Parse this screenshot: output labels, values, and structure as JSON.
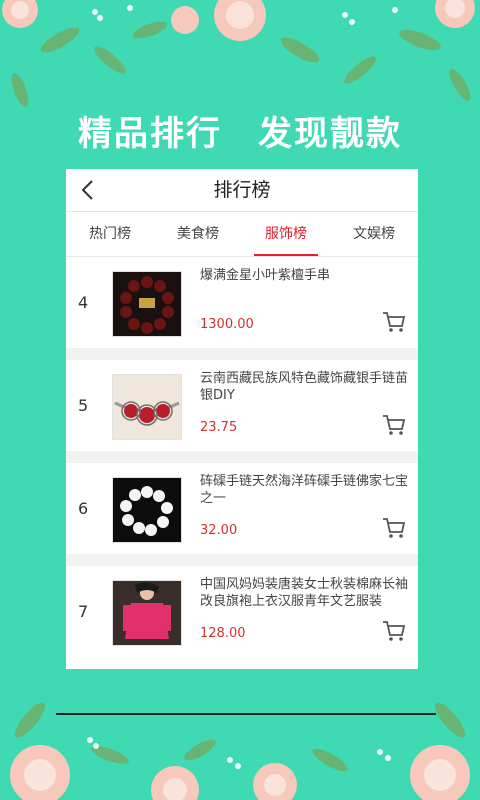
{
  "headline": "精品排行　发现靓款",
  "title": "排行榜",
  "colors": {
    "background": "#3fd9b4",
    "accent": "#e0202e",
    "price": "#d0332c"
  },
  "tabs": [
    {
      "label": "热门榜",
      "active": false
    },
    {
      "label": "美食榜",
      "active": false
    },
    {
      "label": "服饰榜",
      "active": true
    },
    {
      "label": "文娱榜",
      "active": false
    }
  ],
  "items": [
    {
      "rank": "4",
      "name": "爆满金星小叶紫檀手串",
      "price": "1300.00"
    },
    {
      "rank": "5",
      "name": "云南西藏民族风特色藏饰藏银手链苗银DIY",
      "price": "23.75"
    },
    {
      "rank": "6",
      "name": "砗磲手链天然海洋砗磲手链佛家七宝之一",
      "price": "32.00"
    },
    {
      "rank": "7",
      "name": "中国风妈妈装唐装女士秋装棉麻长袖改良旗袍上衣汉服青年文艺服装",
      "price": "128.00"
    }
  ],
  "icons": {
    "back": "chevron-left-icon",
    "cart": "cart-icon"
  }
}
